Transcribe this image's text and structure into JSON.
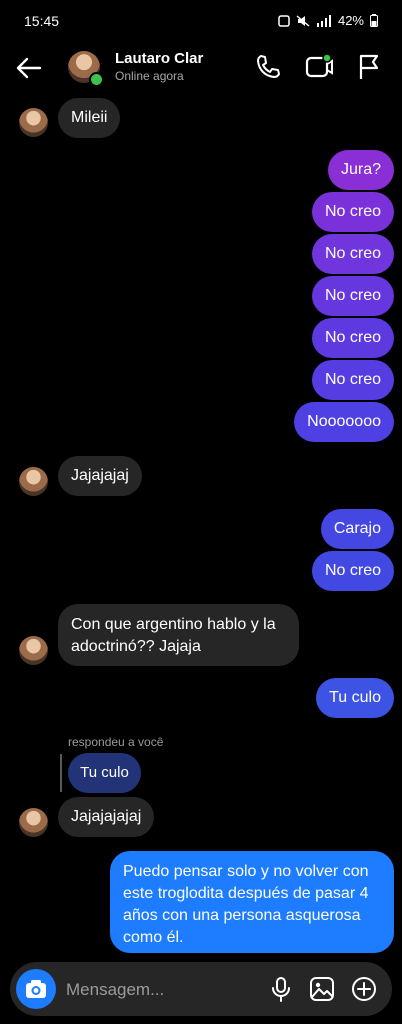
{
  "status_bar": {
    "time": "15:45",
    "battery": "42%"
  },
  "header": {
    "name": "Lautaro Clar",
    "status": "Online agora"
  },
  "icons": {
    "back": "arrow-left-icon",
    "call": "phone-icon",
    "video": "video-icon",
    "report": "flag-icon",
    "camera": "camera-icon",
    "mic": "microphone-icon",
    "gallery": "image-icon",
    "add": "plus-circle-icon"
  },
  "messages": [
    {
      "from": "them",
      "text": "Mileii"
    },
    {
      "from": "me",
      "text": "Jura?"
    },
    {
      "from": "me",
      "text": "No creo"
    },
    {
      "from": "me",
      "text": "No creo"
    },
    {
      "from": "me",
      "text": "No creo"
    },
    {
      "from": "me",
      "text": "No creo"
    },
    {
      "from": "me",
      "text": "No creo"
    },
    {
      "from": "me",
      "text": "Nooooooo"
    },
    {
      "from": "them",
      "text": "Jajajajaj"
    },
    {
      "from": "me",
      "text": "Carajo"
    },
    {
      "from": "me",
      "text": "No creo"
    },
    {
      "from": "them",
      "text": "Con que argentino hablo y la adoctrinó?? Jajaja"
    },
    {
      "from": "me",
      "text": "Tu culo"
    },
    {
      "from": "them",
      "text": "Jajajajajaj"
    },
    {
      "from": "me",
      "text": "Puedo pensar solo y no volver con este troglodita después de pasar 4 años con una persona asquerosa como él."
    }
  ],
  "reply": {
    "label": "respondeu a você",
    "quoted": "Tu culo"
  },
  "composer": {
    "placeholder": "Mensagem..."
  },
  "colors": {
    "bubble_purple": "#8a2fd6",
    "bubble_blue": "#1d7cff",
    "incoming": "#262626",
    "online": "#3cc24a"
  }
}
